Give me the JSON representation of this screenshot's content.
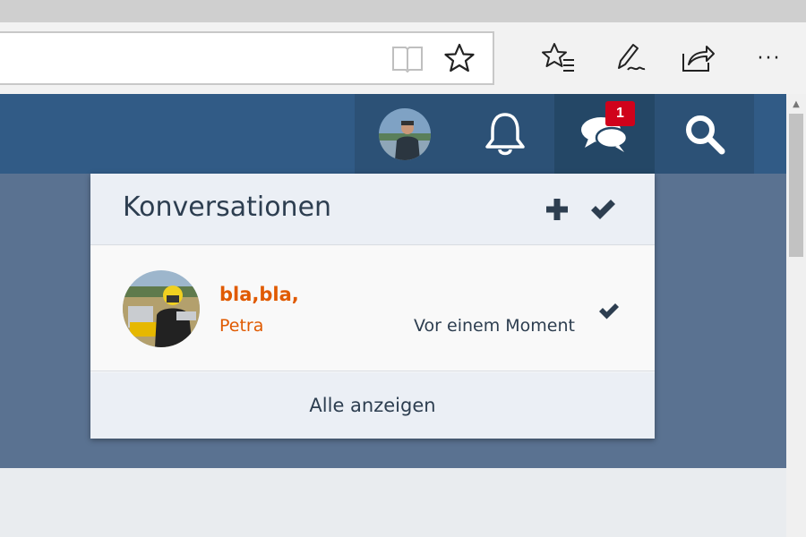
{
  "browser": {
    "icons": {
      "reading_view": "book-open-icon",
      "favorite": "star-icon",
      "favorites_hub": "star-list-icon",
      "web_note": "pen-icon",
      "share": "share-icon",
      "more": "more-icon"
    },
    "more_label": "···"
  },
  "nav": {
    "icons": {
      "avatar": "user-avatar",
      "notifications": "bell-icon",
      "conversations": "chat-bubbles-icon",
      "search": "search-icon"
    },
    "conversation_badge": "1",
    "colors": {
      "header": "#315b86",
      "badge": "#d0021b"
    }
  },
  "dropdown": {
    "title": "Konversationen",
    "icons": {
      "start": "plus-icon",
      "mark_all_read": "check-icon"
    },
    "items": [
      {
        "subject": "bla,bla,",
        "user": "Petra",
        "time": "Vor einem Moment",
        "read_icon": "check-icon"
      }
    ],
    "footer": "Alle anzeigen",
    "colors": {
      "accent": "#e05a00",
      "text": "#2d3e50"
    }
  }
}
